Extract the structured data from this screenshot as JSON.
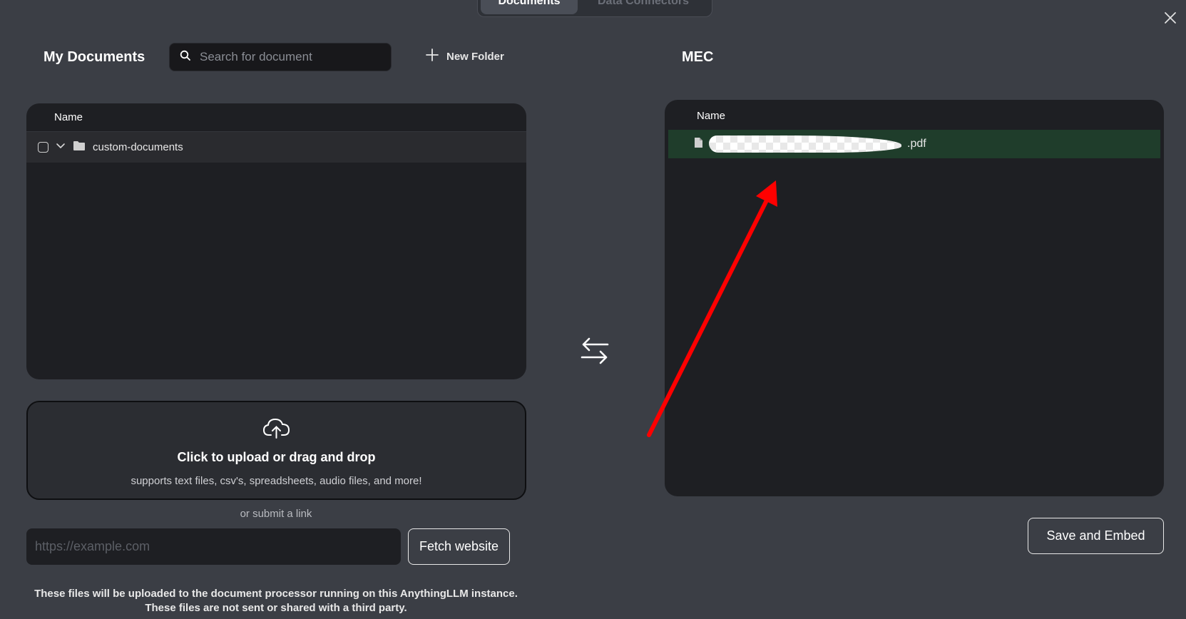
{
  "tabs": [
    {
      "label": "Documents",
      "active": true
    },
    {
      "label": "Data Connectors",
      "active": false
    }
  ],
  "left": {
    "title": "My Documents",
    "search_placeholder": "Search for document",
    "new_folder_label": "New Folder",
    "column_header": "Name",
    "folder_name": "custom-documents"
  },
  "upload": {
    "main_text": "Click to upload or drag and drop",
    "sub_text": "supports text files, csv's, spreadsheets, audio files, and more!"
  },
  "link": {
    "or_text": "or submit a link",
    "placeholder": "https://example.com",
    "fetch_label": "Fetch website"
  },
  "footer": {
    "line1": "These files will be uploaded to the document processor running on this AnythingLLM instance.",
    "line2": "These files are not sent or shared with a third party."
  },
  "right": {
    "title": "MEC",
    "column_header": "Name",
    "file_suffix": ".pdf",
    "save_label": "Save and Embed"
  },
  "colors": {
    "background": "#3b3e45",
    "panel": "#1e1f23",
    "selected_row": "#1f3d2b",
    "annotation_arrow": "#ff0000"
  },
  "icons": {
    "search": "search-icon",
    "plus": "plus-icon",
    "close": "close-icon",
    "chevron": "chevron-down-icon",
    "folder": "folder-icon",
    "file": "file-icon",
    "cloud_upload": "cloud-upload-icon",
    "swap": "swap-arrows-icon"
  }
}
